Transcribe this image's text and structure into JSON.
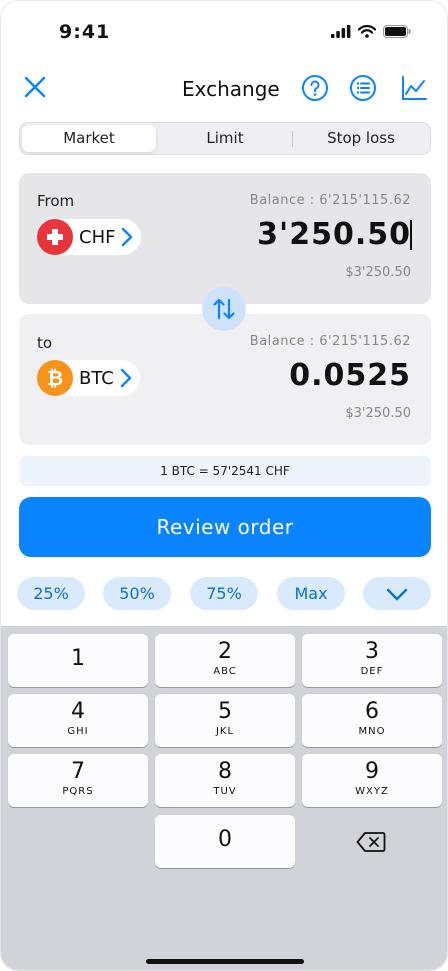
{
  "status": {
    "time": "9:41"
  },
  "nav": {
    "title": "Exchange"
  },
  "tabs": [
    {
      "label": "Market",
      "active": true
    },
    {
      "label": "Limit",
      "active": false
    },
    {
      "label": "Stop loss",
      "active": false
    }
  ],
  "from": {
    "label": "From",
    "currency": "CHF",
    "balance": "Balance : 6'215'115.62",
    "amount": "3'250.50",
    "fiat": "$3'250.50"
  },
  "to": {
    "label": "to",
    "currency": "BTC",
    "balance": "Balance : 6'215'115.62",
    "amount": "0.0525",
    "fiat": "$3'250.50"
  },
  "rate": "1 BTC = 57'2541 CHF",
  "review_label": "Review order",
  "quick": [
    "25%",
    "50%",
    "75%",
    "Max"
  ],
  "keys": [
    {
      "d": "1",
      "l": ""
    },
    {
      "d": "2",
      "l": "ABC"
    },
    {
      "d": "3",
      "l": "DEF"
    },
    {
      "d": "4",
      "l": "GHI"
    },
    {
      "d": "5",
      "l": "JKL"
    },
    {
      "d": "6",
      "l": "MNO"
    },
    {
      "d": "7",
      "l": "PQRS"
    },
    {
      "d": "8",
      "l": "TUV"
    },
    {
      "d": "9",
      "l": "WXYZ"
    },
    {
      "d": "0",
      "l": ""
    }
  ],
  "colors": {
    "accent": "#0a84ff",
    "swiss_red": "#e8353b",
    "bitcoin": "#f7931a"
  },
  "icons": [
    "close-icon",
    "help-icon",
    "list-icon",
    "chart-icon",
    "swap-icon",
    "chevron-down-icon",
    "backspace-icon",
    "swiss-flag-icon",
    "bitcoin-icon"
  ]
}
